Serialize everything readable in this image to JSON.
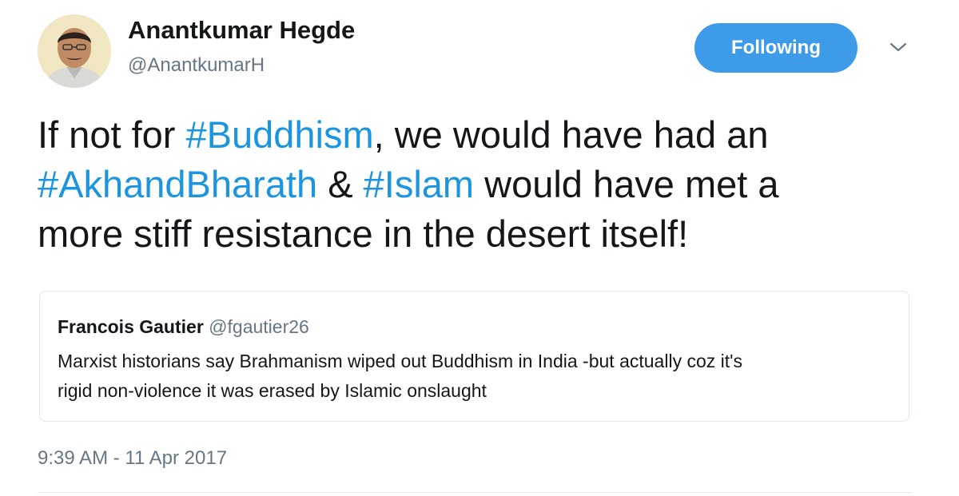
{
  "author": {
    "name": "Anantkumar Hegde",
    "handle": "@AnantkumarH",
    "avatar_icon": "profile-photo"
  },
  "follow_button": {
    "label": "Following",
    "color": "#3d9be9"
  },
  "menu": {
    "icon": "chevron-down-icon"
  },
  "tweet": {
    "line1": {
      "pre": "If not for ",
      "tag1": "#Buddhism",
      "post": ", we would have had an"
    },
    "line2": {
      "tag1": "#AkhandBharath",
      "mid": " & ",
      "tag2": "#Islam",
      "post": " would have met a"
    },
    "line3": "more stiff resistance in the desert itself!",
    "hashtag_color": "#1b95e0"
  },
  "quoted_tweet": {
    "name": "Francois Gautier",
    "handle": "@fgautier26",
    "text_line1": "Marxist historians say Brahmanism wiped out Buddhism in India -but actually coz it's",
    "text_line2": "rigid non-violence it was erased by Islamic onslaught"
  },
  "timestamp": "9:39 AM - 11 Apr 2017"
}
